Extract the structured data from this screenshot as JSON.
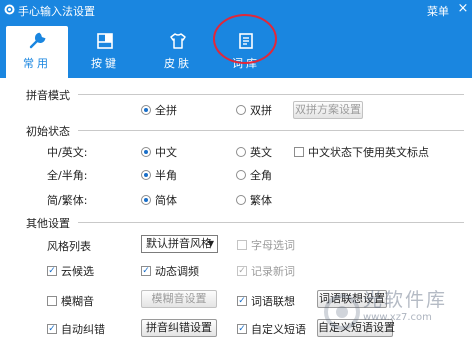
{
  "window": {
    "title": "手心输入法设置",
    "menu_label": "菜单",
    "close_glyph": "×"
  },
  "tabs": [
    {
      "label": "常用",
      "icon": "wrench-icon",
      "active": true
    },
    {
      "label": "按键",
      "icon": "keyboard-icon",
      "active": false
    },
    {
      "label": "皮肤",
      "icon": "tshirt-icon",
      "active": false
    },
    {
      "label": "词库",
      "icon": "document-icon",
      "active": false
    }
  ],
  "pinyin_mode": {
    "heading": "拼音模式",
    "options": [
      {
        "label": "全拼",
        "selected": true
      },
      {
        "label": "双拼",
        "selected": false
      }
    ],
    "scheme_button": "双拼方案设置"
  },
  "initial_state": {
    "heading": "初始状态",
    "rows": [
      {
        "label": "中/英文:",
        "options": [
          {
            "label": "中文",
            "selected": true
          },
          {
            "label": "英文",
            "selected": false
          }
        ]
      },
      {
        "label": "全/半角:",
        "options": [
          {
            "label": "半角",
            "selected": true
          },
          {
            "label": "全角",
            "selected": false
          }
        ]
      },
      {
        "label": "简/繁体:",
        "options": [
          {
            "label": "简体",
            "selected": true
          },
          {
            "label": "繁体",
            "selected": false
          }
        ]
      }
    ],
    "english_punct_checkbox": {
      "label": "中文状态下使用英文标点",
      "checked": false
    }
  },
  "other_settings": {
    "heading": "其他设置",
    "style_label": "风格列表",
    "style_value": "默认拼音风格",
    "letter_select": {
      "label": "字母选词",
      "checked": false,
      "disabled": true
    },
    "cloud_candidate": {
      "label": "云候选",
      "checked": true
    },
    "dynamic_freq": {
      "label": "动态调频",
      "checked": true
    },
    "record_new_words": {
      "label": "记录新词",
      "checked": true,
      "disabled": true
    },
    "fuzzy": {
      "label": "模糊音",
      "checked": false
    },
    "fuzzy_button": "模糊音设置",
    "word_assoc": {
      "label": "词语联想",
      "checked": true
    },
    "word_assoc_button": "词语联想设置",
    "auto_correct": {
      "label": "自动纠错",
      "checked": true
    },
    "correct_button": "拼音纠错设置",
    "custom_phrase": {
      "label": "自定义短语",
      "checked": true
    },
    "custom_phrase_button": "自定义短语设置"
  },
  "watermark": {
    "text": "光软件库",
    "url": "www.xz7.com"
  },
  "colors": {
    "accent": "#1a86e0",
    "highlight_ring": "#e0283a"
  }
}
